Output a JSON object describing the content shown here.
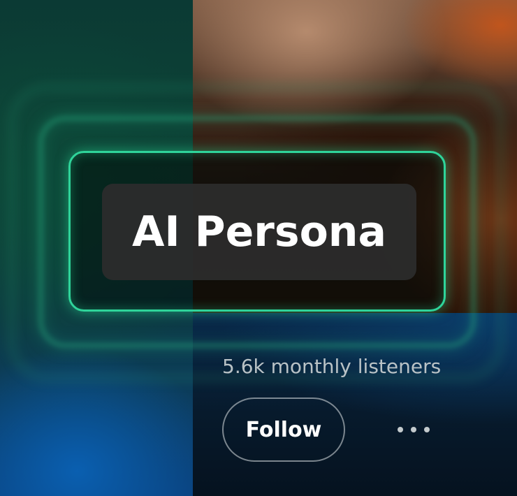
{
  "artist": {
    "name": "AI Persona",
    "monthly_listeners": "5.6k monthly listeners"
  },
  "actions": {
    "follow_label": "Follow",
    "more_icon": "more-horizontal-icon"
  },
  "colors": {
    "frame_glow": "#2fd49a",
    "title_pill": "#2c2c2c",
    "text_primary": "#ffffff",
    "text_secondary": "#b9c2c6"
  }
}
